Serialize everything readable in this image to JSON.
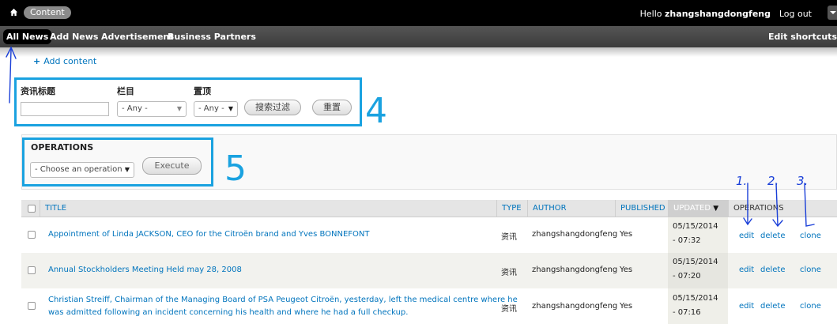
{
  "toolbar": {
    "content_label": "Content",
    "greeting_prefix": "Hello ",
    "username": "zhangshangdongfeng",
    "logout_label": "Log out"
  },
  "shortcuts": {
    "items": [
      "All News",
      "Add News",
      "Advertisement",
      "Business Partners"
    ],
    "edit_label": "Edit shortcuts"
  },
  "add_content_label": "Add content",
  "filters": {
    "title_label": "资讯标题",
    "title_value": "",
    "category_label": "栏目",
    "category_value": "- Any -",
    "sticky_label": "置顶",
    "sticky_value": "- Any -",
    "search_button": "搜索过滤",
    "reset_button": "重置"
  },
  "operations": {
    "title": "OPERATIONS",
    "select_value": "- Choose an operation -",
    "execute_button": "Execute"
  },
  "annotations": {
    "box4": "4",
    "box5": "5",
    "n1": "1.",
    "n2": "2.",
    "n3": "3."
  },
  "table": {
    "headers": {
      "title": "TITLE",
      "type": "TYPE",
      "author": "AUTHOR",
      "published": "PUBLISHED",
      "updated": "UPDATED",
      "operations": "OPERATIONS"
    },
    "rows": [
      {
        "title": "Appointment of Linda JACKSON, CEO for the Citroën brand and Yves BONNEFONT",
        "title2": "",
        "type": "资讯",
        "author": "zhangshangdongfeng",
        "published": "Yes",
        "date": "05/15/2014",
        "time": "- 07:32",
        "edit": "edit",
        "delete": "delete",
        "clone": "clone"
      },
      {
        "title": "Annual Stockholders Meeting Held may 28, 2008",
        "title2": "",
        "type": "资讯",
        "author": "zhangshangdongfeng",
        "published": "Yes",
        "date": "05/15/2014",
        "time": "- 07:20",
        "edit": "edit",
        "delete": "delete",
        "clone": "clone"
      },
      {
        "title": "Christian Streiff, Chairman of the Managing Board of PSA Peugeot Citroën, yesterday, left the medical centre where he",
        "title2": "was admitted following an incident concerning his health and where he had a full checkup.",
        "type": "资讯",
        "author": "zhangshangdongfeng",
        "published": "Yes",
        "date": "05/15/2014",
        "time": "- 07:16",
        "edit": "edit",
        "delete": "delete",
        "clone": "clone"
      }
    ]
  },
  "colors": {
    "link": "#0074bd",
    "annotation": "#1aa2e0",
    "toolbar_bg": "#000000"
  }
}
